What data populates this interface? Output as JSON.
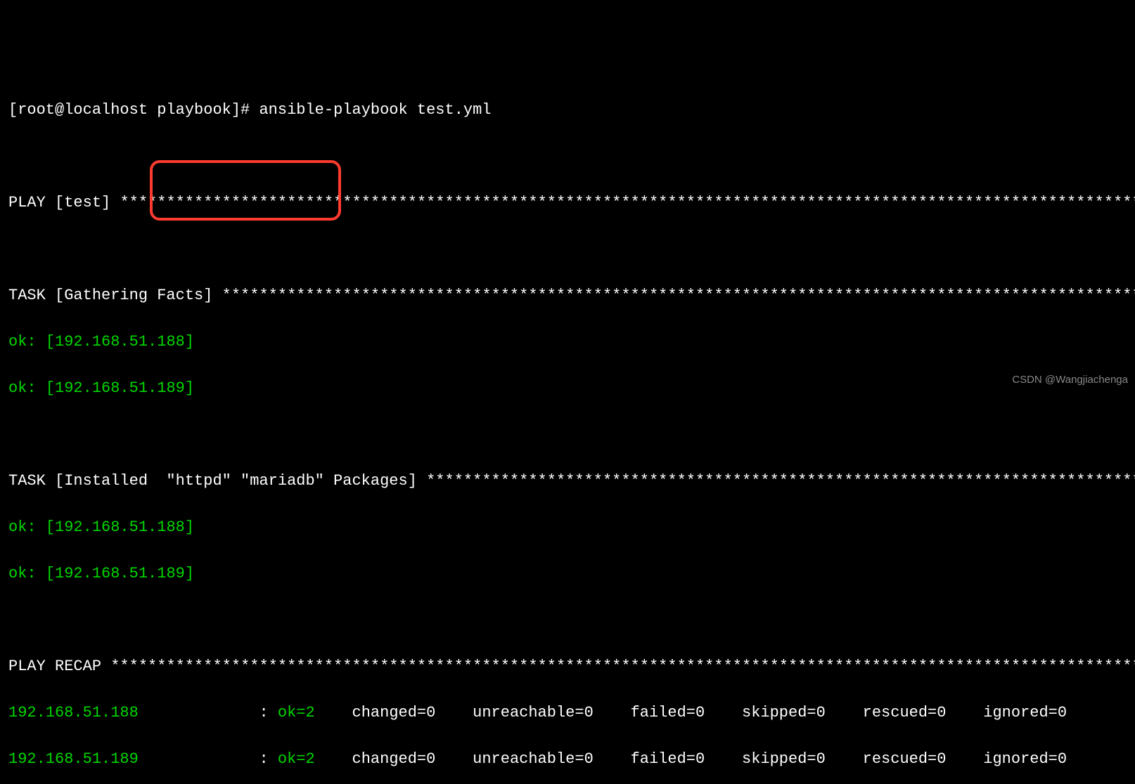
{
  "prompt": {
    "user_host": "[root@localhost playbook]#",
    "command": "ansible-playbook test.yml"
  },
  "play_header": {
    "label": "PLAY [test] ",
    "stars": "***********************************************************************************************************************"
  },
  "task_gathering": {
    "label": "TASK [Gathering Facts] ",
    "stars": "************************************************************************************************************"
  },
  "gathering_results": {
    "r1_status": "ok: ",
    "r1_host": "[192.168.51.188]",
    "r2_status": "ok: ",
    "r2_host": "[192.168.51.189]"
  },
  "task_install": {
    "prefix": "TASK [Installed ",
    "highlight": " \"httpd\" \"mariadb\" ",
    "suffix": "Packages] ",
    "stars": "**************************************************************************************"
  },
  "install_results": {
    "r1_status": "ok: ",
    "r1_host": "[192.168.51.188]",
    "r2_status": "ok: ",
    "r2_host": "[192.168.51.189]"
  },
  "recap_header": {
    "label": "PLAY RECAP ",
    "stars": "************************************************************************************************************************"
  },
  "recap": {
    "row1": {
      "host": "192.168.51.188",
      "colon": "             : ",
      "ok": "ok=2",
      "rest": "    changed=0    unreachable=0    failed=0    skipped=0    rescued=0    ignored=0"
    },
    "row2": {
      "host": "192.168.51.189",
      "colon": "             : ",
      "ok": "ok=2",
      "rest": "    changed=0    unreachable=0    failed=0    skipped=0    rescued=0    ignored=0"
    }
  },
  "watermark": "CSDN @Wangjiachenga"
}
